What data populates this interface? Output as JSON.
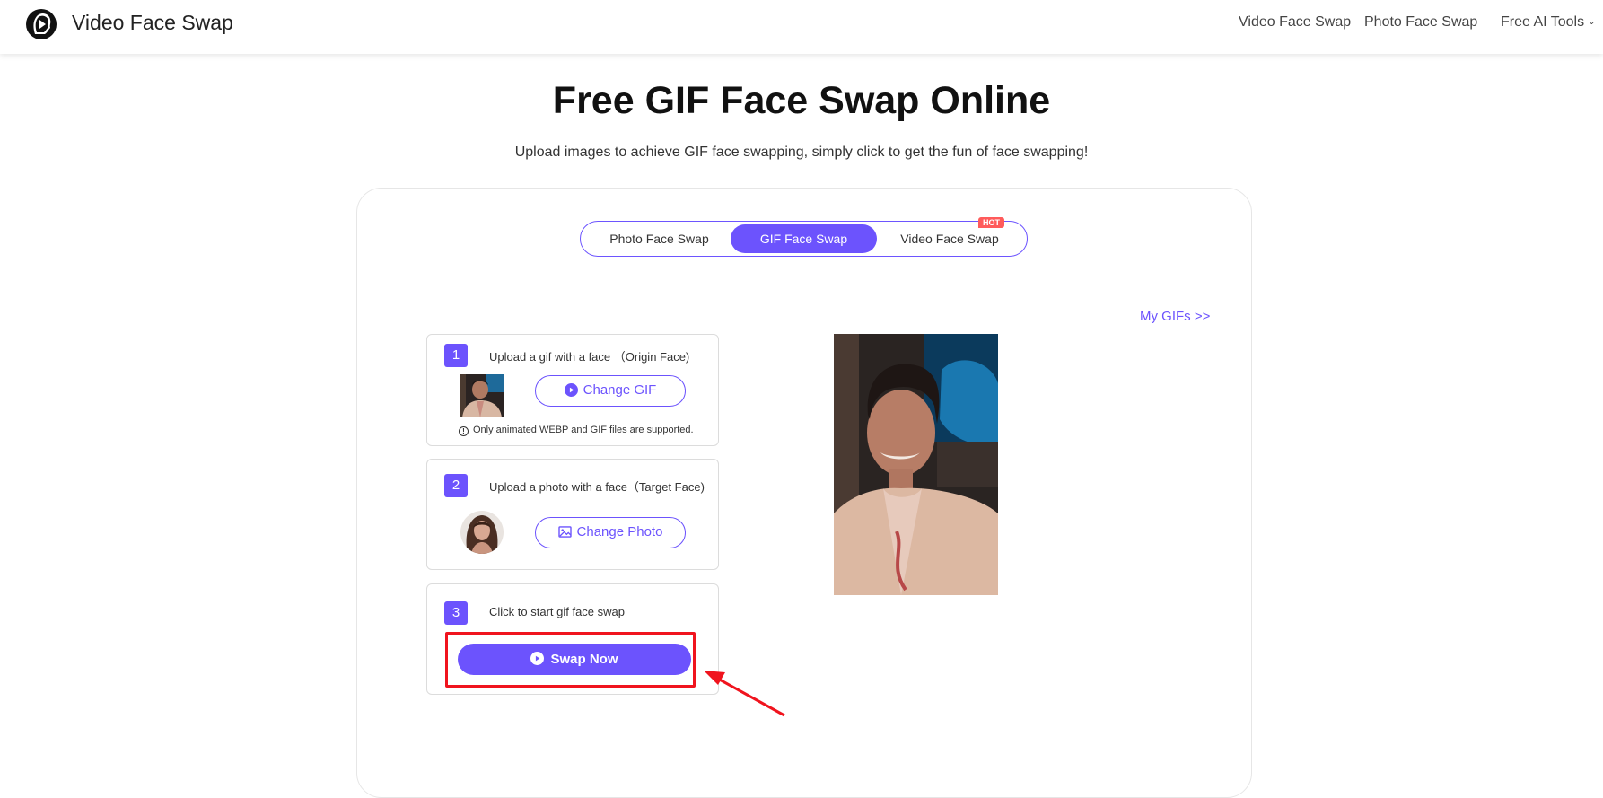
{
  "header": {
    "brand": "Video Face Swap",
    "logo_icon": "face-play-logo-icon",
    "nav": [
      {
        "label": "Video Face Swap"
      },
      {
        "label": "Photo Face Swap"
      },
      {
        "label": "Free AI Tools",
        "dropdown": true,
        "chevron": "⌄"
      }
    ]
  },
  "hero": {
    "title": "Free GIF Face Swap Online",
    "subtitle": "Upload images to achieve GIF face swapping, simply click to get the fun of face swapping!"
  },
  "tabs": {
    "items": [
      {
        "label": "Photo Face Swap",
        "active": false
      },
      {
        "label": "GIF Face Swap",
        "active": true
      },
      {
        "label": "Video Face Swap",
        "active": false,
        "badge": "HOT"
      }
    ]
  },
  "links": {
    "my_gifs": "My GIFs >>"
  },
  "steps": [
    {
      "number": "1",
      "title": "Upload a gif with a face （Origin Face)",
      "button": "Change GIF",
      "button_icon": "play-circle-icon",
      "note": "Only animated WEBP and GIF files are supported.",
      "note_icon": "info-icon",
      "note_icon_glyph": "!"
    },
    {
      "number": "2",
      "title": "Upload a photo with a face（Target Face)",
      "button": "Change Photo",
      "button_icon": "image-icon"
    },
    {
      "number": "3",
      "title": "Click to start gif face swap",
      "button": "Swap Now",
      "button_icon": "play-circle-icon"
    }
  ],
  "annotation": {
    "highlight_color": "#f0141e",
    "target": "Swap Now"
  },
  "colors": {
    "accent": "#6c53fd",
    "hot_badge": "#ff5b5b"
  }
}
